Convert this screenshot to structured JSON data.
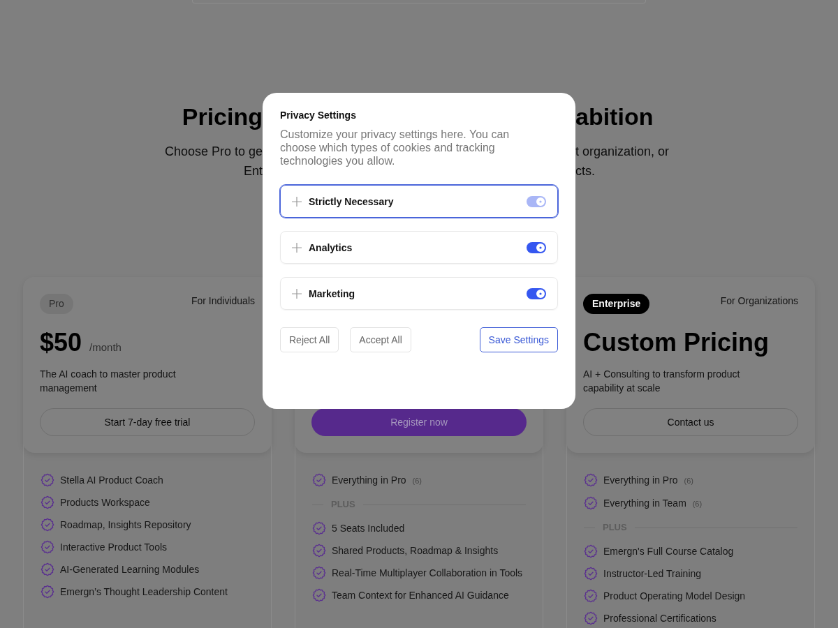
{
  "background_page": {
    "heading": {
      "left_part": "Pricing",
      "right_part": "abition"
    },
    "subtitle_lines": [
      {
        "left_part": "Choose Pro to ge",
        "right_part": "t organization, or"
      },
      {
        "left_part": "Ent",
        "right_part": "cts."
      }
    ],
    "plans": [
      {
        "badge": {
          "label": "Pro",
          "kind": "muted"
        },
        "audience": "For Individuals",
        "price": "$50",
        "period": "/month",
        "description": "The AI coach to master product management",
        "button": {
          "label": "Start 7-day free trial",
          "kind": "outline"
        },
        "features": [
          {
            "kind": "feature",
            "text": "Stella AI Product Coach"
          },
          {
            "kind": "feature",
            "text": "Products Workspace"
          },
          {
            "kind": "feature",
            "text": "Roadmap, Insights Repository"
          },
          {
            "kind": "feature",
            "text": "Interactive Product Tools"
          },
          {
            "kind": "feature",
            "text": "AI-Generated Learning Modules"
          },
          {
            "kind": "feature",
            "text": "Emergn’s Thought Leadership Content"
          }
        ]
      },
      {
        "button": {
          "label": "Register now",
          "kind": "primary"
        },
        "features": [
          {
            "kind": "feature",
            "text": "Everything in Pro",
            "count": "(6)"
          },
          {
            "kind": "divider",
            "label": "PLUS"
          },
          {
            "kind": "feature",
            "text": "5 Seats Included"
          },
          {
            "kind": "feature",
            "text": "Shared Products, Roadmap & Insights"
          },
          {
            "kind": "feature",
            "text": "Real-Time Multiplayer Collaboration in Tools"
          },
          {
            "kind": "feature",
            "text": "Team Context for Enhanced AI Guidance"
          }
        ]
      },
      {
        "badge": {
          "label": "Enterprise",
          "kind": "dark"
        },
        "audience": "For Organizations",
        "price": "Custom Pricing",
        "description": "AI + Consulting to transform product capability at scale",
        "button": {
          "label": "Contact us",
          "kind": "outline"
        },
        "features": [
          {
            "kind": "feature",
            "text": "Everything in Pro",
            "count": "(6)"
          },
          {
            "kind": "feature",
            "text": "Everything in Team",
            "count": "(6)"
          },
          {
            "kind": "divider",
            "label": "PLUS"
          },
          {
            "kind": "feature",
            "text": "Emergn's Full Course Catalog"
          },
          {
            "kind": "feature",
            "text": "Instructor-Led Training"
          },
          {
            "kind": "feature",
            "text": "Product Operating Model Design"
          },
          {
            "kind": "feature",
            "text": "Professional Certifications"
          }
        ]
      }
    ]
  },
  "privacy_dialog": {
    "title": "Privacy Settings",
    "description": "Customize your privacy settings here. You can choose which types of cookies and tracking technologies you allow.",
    "categories": [
      {
        "label": "Strictly Necessary",
        "selected": true,
        "on": true,
        "disabled": true
      },
      {
        "label": "Analytics",
        "selected": false,
        "on": true,
        "disabled": false
      },
      {
        "label": "Marketing",
        "selected": false,
        "on": true,
        "disabled": false
      }
    ],
    "buttons": [
      {
        "label": "Reject All",
        "kind": "secondary"
      },
      {
        "label": "Accept All",
        "kind": "secondary"
      },
      {
        "label": "Save Settings",
        "kind": "primary"
      }
    ]
  }
}
